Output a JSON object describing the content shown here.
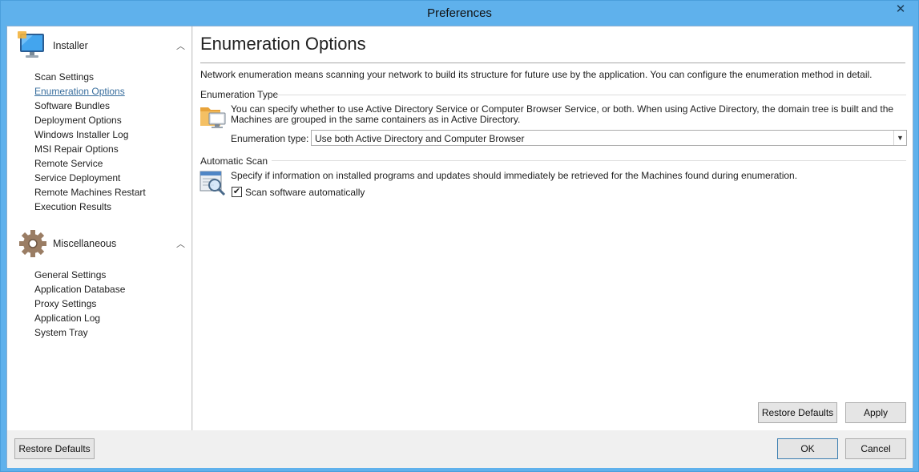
{
  "window": {
    "title": "Preferences",
    "close_glyph": "✕"
  },
  "sidebar": {
    "groups": [
      {
        "title": "Installer",
        "icon": "monitor-icon",
        "items": [
          "Scan Settings",
          "Enumeration Options",
          "Software Bundles",
          "Deployment Options",
          "Windows Installer Log",
          "MSI Repair Options",
          "Remote Service",
          "Service Deployment",
          "Remote Machines Restart",
          "Execution Results"
        ],
        "active_item": "Enumeration Options"
      },
      {
        "title": "Miscellaneous",
        "icon": "gear-icon",
        "items": [
          "General Settings",
          "Application Database",
          "Proxy Settings",
          "Application Log",
          "System Tray"
        ]
      }
    ],
    "collapse_glyph": "︿"
  },
  "main": {
    "title": "Enumeration Options",
    "description": "Network enumeration means scanning your network to build its structure for future use by the application. You can configure the enumeration method in detail.",
    "enumeration_type": {
      "label": "Enumeration Type",
      "icon": "folder-computer-icon",
      "description": "You can specify whether to use Active Directory Service or Computer Browser Service, or both. When using Active Directory, the domain tree is built and the Machines are grouped in the same containers as in Active Directory.",
      "field_label": "Enumeration type:",
      "selected_value": "Use both Active Directory and Computer Browser",
      "arrow_glyph": "▼"
    },
    "automatic_scan": {
      "label": "Automatic Scan",
      "icon": "scan-magnifier-icon",
      "description": "Specify if information on installed programs and updates should immediately be retrieved for the Machines found during enumeration.",
      "checkbox_label": "Scan software automatically",
      "checked": true,
      "check_glyph": "✔"
    },
    "buttons": {
      "restore_defaults": "Restore Defaults",
      "apply": "Apply"
    }
  },
  "footer": {
    "restore_defaults": "Restore Defaults",
    "ok": "OK",
    "cancel": "Cancel"
  },
  "colors": {
    "title_bar": "#5fb1ec",
    "panel_background": "#f0f0f0",
    "active_link": "#3a6f9e"
  }
}
